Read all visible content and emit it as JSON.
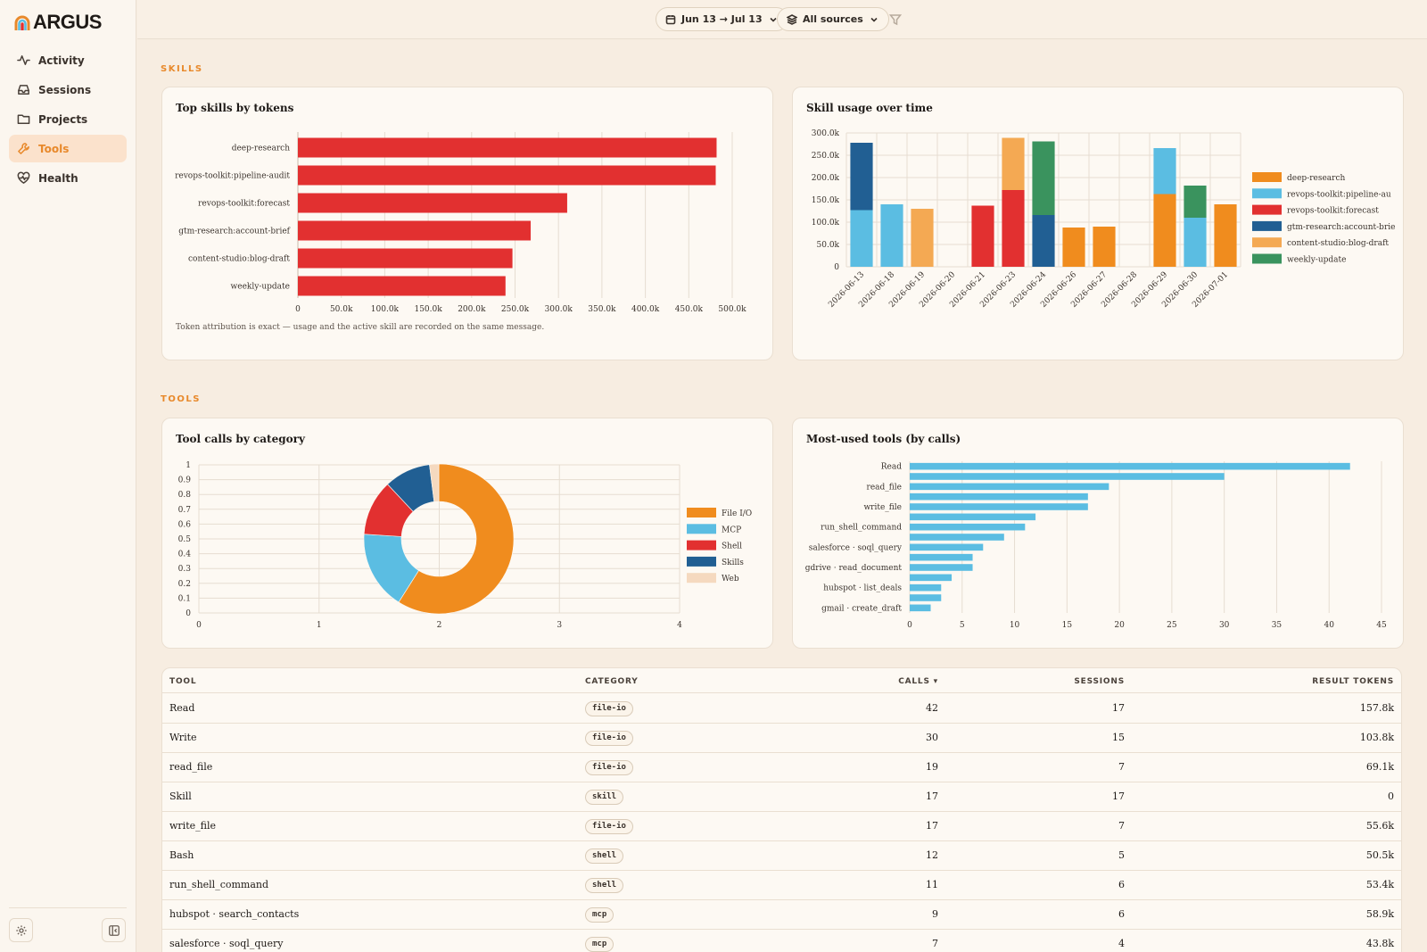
{
  "app": {
    "name": "ARGUS"
  },
  "sidebar": {
    "items": [
      {
        "label": "Activity",
        "icon": "activity-icon"
      },
      {
        "label": "Sessions",
        "icon": "inbox-icon"
      },
      {
        "label": "Projects",
        "icon": "folder-icon"
      },
      {
        "label": "Tools",
        "icon": "wrench-icon",
        "active": true
      },
      {
        "label": "Health",
        "icon": "heart-pulse-icon"
      }
    ]
  },
  "topbar": {
    "date_range": "Jun 13 → Jul 13",
    "sources": "All sources"
  },
  "sections": {
    "skills": "SKILLS",
    "tools": "TOOLS"
  },
  "skills_top": {
    "title": "Top skills by tokens",
    "note": "Token attribution is exact — usage and the active skill are recorded on the same message.",
    "chart_data": {
      "type": "bar",
      "orientation": "horizontal",
      "categories": [
        "deep-research",
        "revops-toolkit:pipeline-audit",
        "revops-toolkit:forecast",
        "gtm-research:account-brief",
        "content-studio:blog-draft",
        "weekly-update"
      ],
      "values": [
        482000,
        481000,
        310000,
        268000,
        247000,
        239000
      ],
      "xlim": [
        0,
        500000
      ],
      "xticks": [
        "0",
        "50.0k",
        "100.0k",
        "150.0k",
        "200.0k",
        "250.0k",
        "300.0k",
        "350.0k",
        "400.0k",
        "450.0k",
        "500.0k"
      ],
      "color": "#e23030",
      "grid": true
    }
  },
  "skills_time": {
    "title": "Skill usage over time",
    "chart_data": {
      "type": "bar",
      "stacked": true,
      "categories": [
        "2026-06-13",
        "2026-06-18",
        "2026-06-19",
        "2026-06-20",
        "2026-06-21",
        "2026-06-23",
        "2026-06-24",
        "2026-06-26",
        "2026-06-27",
        "2026-06-28",
        "2026-06-29",
        "2026-06-30",
        "2026-07-01"
      ],
      "ylim": [
        0,
        300000
      ],
      "yticks": [
        "0",
        "50.0k",
        "100.0k",
        "150.0k",
        "200.0k",
        "250.0k",
        "300.0k"
      ],
      "series": [
        {
          "name": "deep-research",
          "color": "#f08c1e",
          "values": [
            0,
            0,
            0,
            0,
            0,
            0,
            0,
            88000,
            90000,
            0,
            163000,
            0,
            140000
          ]
        },
        {
          "name": "revops-toolkit:pipeline-audit",
          "color": "#5bbde2",
          "values": [
            127000,
            140000,
            0,
            0,
            0,
            0,
            0,
            0,
            0,
            0,
            103000,
            110000,
            0
          ]
        },
        {
          "name": "revops-toolkit:forecast",
          "color": "#e23030",
          "values": [
            0,
            0,
            0,
            0,
            137000,
            172000,
            0,
            0,
            0,
            0,
            0,
            0,
            0
          ]
        },
        {
          "name": "gtm-research:account-brief",
          "color": "#215f93",
          "values": [
            151000,
            0,
            0,
            0,
            0,
            0,
            116000,
            0,
            0,
            0,
            0,
            0,
            0
          ]
        },
        {
          "name": "content-studio:blog-draft",
          "color": "#f4a953",
          "values": [
            0,
            0,
            130000,
            0,
            0,
            117000,
            0,
            0,
            0,
            0,
            0,
            0,
            0
          ]
        },
        {
          "name": "weekly-update",
          "color": "#3a935e",
          "values": [
            0,
            0,
            0,
            0,
            0,
            0,
            165000,
            0,
            0,
            0,
            0,
            72000,
            0
          ]
        }
      ],
      "legend_labels": [
        "deep-research",
        "revops-toolkit:pipeline-au",
        "revops-toolkit:forecast",
        "gtm-research:account-brie",
        "content-studio:blog-draft",
        "weekly-update"
      ],
      "legend": "right",
      "grid": true
    }
  },
  "tool_categories": {
    "title": "Tool calls by category",
    "chart_data": {
      "type": "pie",
      "donut": true,
      "labels": [
        "File I/O",
        "MCP",
        "Shell",
        "Skills",
        "Web"
      ],
      "values": [
        59,
        17,
        12,
        10,
        2
      ],
      "colors": [
        "#f08c1e",
        "#5bbde2",
        "#e23030",
        "#215f93",
        "#f5d9bf"
      ],
      "xticks": [
        "0",
        "1",
        "2",
        "3",
        "4"
      ],
      "yticks": [
        "0",
        "0.1",
        "0.2",
        "0.3",
        "0.4",
        "0.5",
        "0.6",
        "0.7",
        "0.8",
        "0.9",
        "1"
      ],
      "legend": "right"
    }
  },
  "tools_top": {
    "title": "Most-used tools (by calls)",
    "chart_data": {
      "type": "bar",
      "orientation": "horizontal",
      "labels": [
        "Read",
        "",
        "read_file",
        "",
        "write_file",
        "",
        "run_shell_command",
        "",
        "salesforce · soql_query",
        "",
        "gdrive · read_document",
        "",
        "hubspot · list_deals",
        "",
        "gmail · create_draft"
      ],
      "values": [
        42,
        30,
        19,
        17,
        17,
        12,
        11,
        9,
        7,
        6,
        6,
        4,
        3,
        3,
        2
      ],
      "xlim": [
        0,
        45
      ],
      "xticks": [
        "0",
        "5",
        "10",
        "15",
        "20",
        "25",
        "30",
        "35",
        "40",
        "45"
      ],
      "color": "#5bbde2",
      "grid": true
    }
  },
  "table": {
    "headers": {
      "tool": "TOOL",
      "category": "CATEGORY",
      "calls": "CALLS ▾",
      "sessions": "SESSIONS",
      "tokens": "RESULT TOKENS"
    },
    "rows": [
      {
        "tool": "Read",
        "category": "file-io",
        "calls": "42",
        "sessions": "17",
        "tokens": "157.8k"
      },
      {
        "tool": "Write",
        "category": "file-io",
        "calls": "30",
        "sessions": "15",
        "tokens": "103.8k"
      },
      {
        "tool": "read_file",
        "category": "file-io",
        "calls": "19",
        "sessions": "7",
        "tokens": "69.1k"
      },
      {
        "tool": "Skill",
        "category": "skill",
        "calls": "17",
        "sessions": "17",
        "tokens": "0"
      },
      {
        "tool": "write_file",
        "category": "file-io",
        "calls": "17",
        "sessions": "7",
        "tokens": "55.6k"
      },
      {
        "tool": "Bash",
        "category": "shell",
        "calls": "12",
        "sessions": "5",
        "tokens": "50.5k"
      },
      {
        "tool": "run_shell_command",
        "category": "shell",
        "calls": "11",
        "sessions": "6",
        "tokens": "53.4k"
      },
      {
        "tool": "hubspot · search_contacts",
        "category": "mcp",
        "calls": "9",
        "sessions": "6",
        "tokens": "58.9k"
      },
      {
        "tool": "salesforce · soql_query",
        "category": "mcp",
        "calls": "7",
        "sessions": "4",
        "tokens": "43.8k"
      }
    ]
  }
}
